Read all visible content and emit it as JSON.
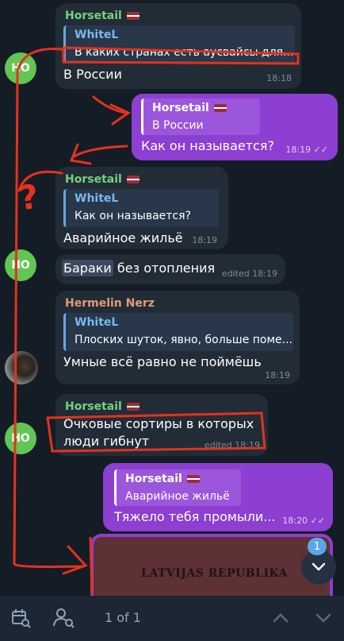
{
  "messages": {
    "m1": {
      "sender": "Horsetail",
      "quote_name": "WhiteL",
      "quote_text": "В каких странах есть аусвайсы для...",
      "text": "В России",
      "time": "18:18"
    },
    "m2": {
      "quote_name": "Horsetail",
      "quote_text": "В России",
      "text": "Как он называется?",
      "time": "18:19"
    },
    "m3": {
      "sender": "Horsetail",
      "quote_name": "WhiteL",
      "quote_text": "Как он называется?",
      "text": "Аварийное жильё",
      "time": "18:19"
    },
    "m4": {
      "highlight": "Бараки",
      "text": " без отопления",
      "time": "edited 18:19"
    },
    "m5": {
      "sender": "Hermelin Nerz",
      "quote_name": "WhiteL",
      "quote_text": "Плоских шуток, явно, больше поме...",
      "text": "Умные всё равно не поймёшь",
      "time": "18:19"
    },
    "m6": {
      "sender": "Horsetail",
      "text_line1": "Очковые сортиры в которых",
      "text_line2": "люди гибнут",
      "time": "edited 18:19"
    },
    "m7": {
      "quote_name": "Horsetail",
      "quote_text": "Аварийное жильё",
      "text": "Тяжело тебя промыли...",
      "time": "18:20"
    },
    "m8": {
      "image_text": "LATVIJAS REPUBLIKA"
    }
  },
  "avatars": {
    "initials": "HO"
  },
  "scroll": {
    "unread_count": "1"
  },
  "annotations": {
    "question_mark": "?"
  },
  "bottom": {
    "counter": "1 of 1"
  },
  "colors": {
    "accent_green": "#74d27e",
    "outgoing": "#8c3fd0",
    "annotation_red": "#e4321e",
    "background": "#141c26"
  }
}
